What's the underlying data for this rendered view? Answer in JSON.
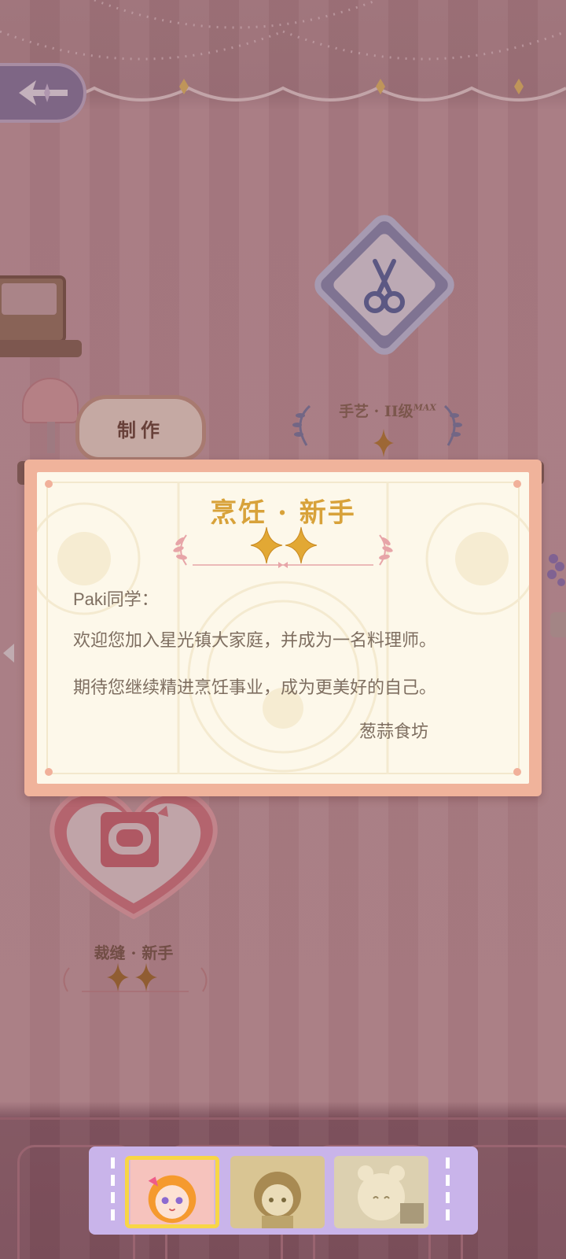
{
  "scene": {
    "make_sign_label": "制作",
    "craft_badge": {
      "label": "手艺 · II级",
      "max_tag": "MAX",
      "stars": 1
    },
    "sewing_badge": {
      "label": "裁缝 · 新手",
      "stars": 2
    }
  },
  "dialog": {
    "title": "烹饪 · 新手",
    "stars": 2,
    "greeting": "Paki同学：",
    "body_line_1": "欢迎您加入星光镇大家庭，并成为一名料理师。",
    "body_line_2": "期待您继续精进烹饪事业，成为更美好的自己。",
    "signature": "葱蒜食坊"
  },
  "character_bar": {
    "characters": [
      {
        "name": "orange-hair-girl",
        "selected": true
      },
      {
        "name": "brown-hair-boy",
        "selected": false
      },
      {
        "name": "bear-ear-girl",
        "selected": false
      }
    ]
  },
  "colors": {
    "card_border": "#f0b39b",
    "card_paper": "#fdf8ea",
    "title_gold": "#d8a23a",
    "body_text": "#7e6e60",
    "char_bar": "#c9b4ea",
    "selected_frame": "#f8d646"
  }
}
